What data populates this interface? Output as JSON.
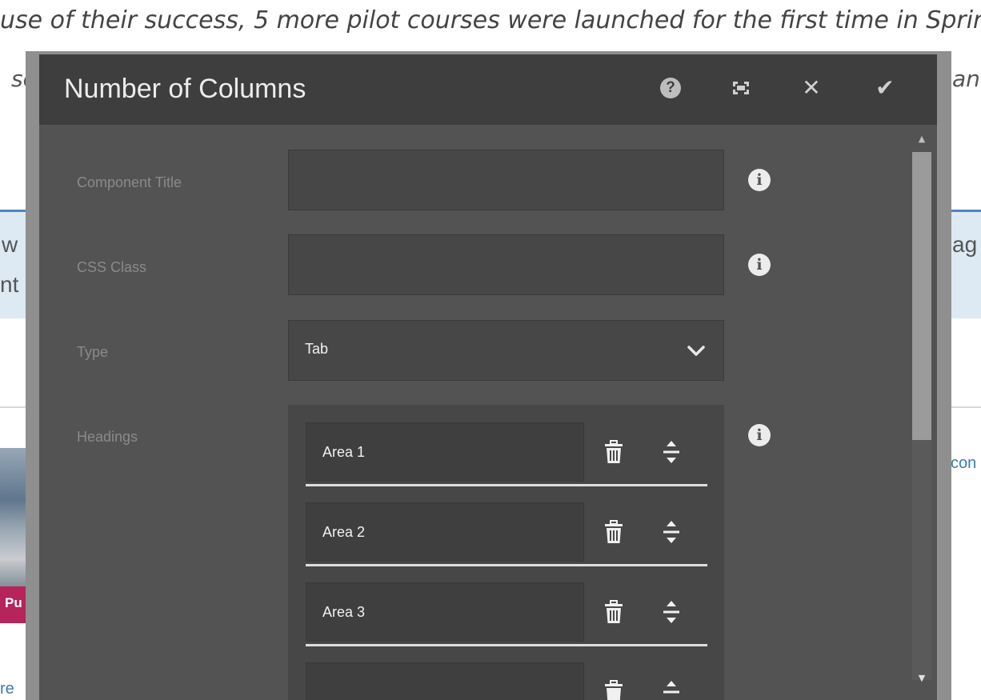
{
  "background": {
    "line1": "use of their success, 5 more pilot courses were launched for the first time in Spring",
    "frag_so": "so",
    "frag_an": "an",
    "frag_w": "w",
    "frag_ag": "ag",
    "frag_nt": "nt",
    "frag_con": "con",
    "frag_pu": "Pu",
    "frag_re": "re"
  },
  "dialog": {
    "title": "Number of Columns",
    "help_label": "?",
    "fullscreen_label": "⌗",
    "close_label": "✕",
    "confirm_label": "✔"
  },
  "form": {
    "component_title": {
      "label": "Component Title",
      "value": ""
    },
    "css_class": {
      "label": "CSS Class",
      "value": ""
    },
    "type": {
      "label": "Type",
      "value": "Tab"
    },
    "headings": {
      "label": "Headings",
      "items": [
        "Area 1",
        "Area 2",
        "Area 3",
        ""
      ]
    }
  },
  "icons": {
    "info": "i",
    "chevron": "⌄",
    "scroll_up": "▲",
    "scroll_down": "▼"
  }
}
